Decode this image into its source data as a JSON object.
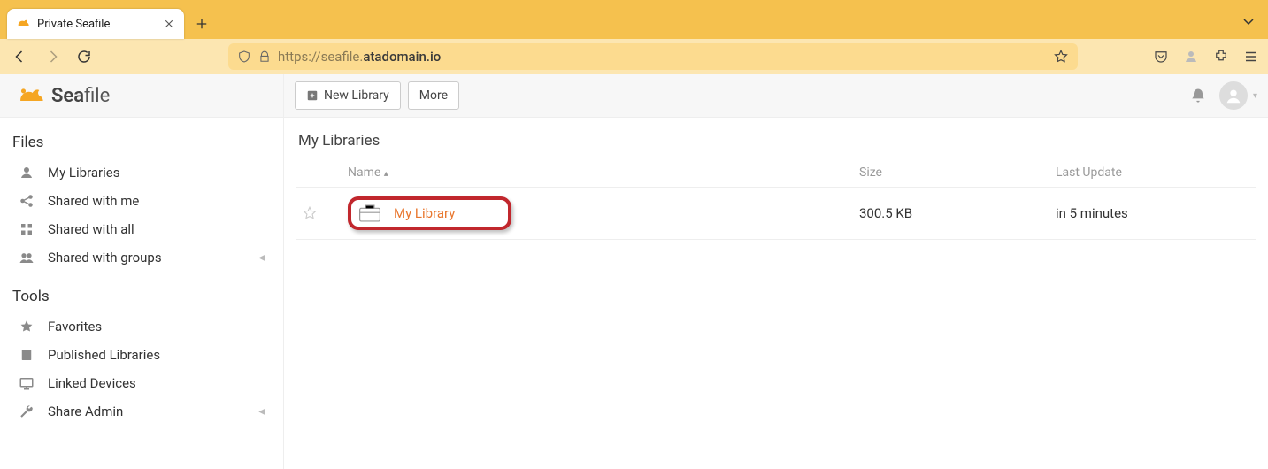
{
  "browser": {
    "tab_title": "Private Seafile",
    "url_grey_prefix": "https://seafile.",
    "url_dark": "atadomain.io"
  },
  "brand": {
    "bold": "Sea",
    "light": "file"
  },
  "sidebar": {
    "files_header": "Files",
    "tools_header": "Tools",
    "files": [
      {
        "label": "My Libraries"
      },
      {
        "label": "Shared with me"
      },
      {
        "label": "Shared with all"
      },
      {
        "label": "Shared with groups"
      }
    ],
    "tools": [
      {
        "label": "Favorites"
      },
      {
        "label": "Published Libraries"
      },
      {
        "label": "Linked Devices"
      },
      {
        "label": "Share Admin"
      }
    ]
  },
  "toolbar": {
    "new_library": "New Library",
    "more": "More"
  },
  "page": {
    "title": "My Libraries",
    "columns": {
      "name": "Name",
      "size": "Size",
      "last_update": "Last Update"
    },
    "rows": [
      {
        "name": "My Library",
        "size": "300.5 KB",
        "last_update": "in 5 minutes"
      }
    ]
  }
}
